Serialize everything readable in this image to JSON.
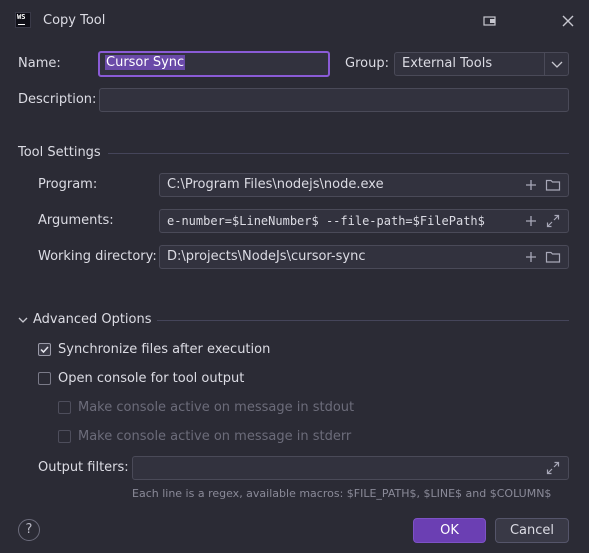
{
  "window": {
    "title": "Copy Tool",
    "app_icon_text": "WS"
  },
  "form": {
    "name_label": "Name:",
    "name_value": "Cursor Sync",
    "group_label": "Group:",
    "group_value": "External Tools",
    "description_label": "Description:",
    "description_value": ""
  },
  "tool_settings": {
    "heading": "Tool Settings",
    "program_label": "Program:",
    "program_value": "C:\\Program Files\\nodejs\\node.exe",
    "arguments_label": "Arguments:",
    "arguments_value": "e-number=$LineNumber$ --file-path=$FilePath$",
    "working_dir_label": "Working directory:",
    "working_dir_value": "D:\\projects\\NodeJs\\cursor-sync"
  },
  "advanced": {
    "heading": "Advanced Options",
    "options": [
      {
        "label": "Synchronize files after execution",
        "checked": true,
        "enabled": true
      },
      {
        "label": "Open console for tool output",
        "checked": false,
        "enabled": true
      },
      {
        "label": "Make console active on message in stdout",
        "checked": false,
        "enabled": false
      },
      {
        "label": "Make console active on message in stderr",
        "checked": false,
        "enabled": false
      }
    ],
    "output_filters_label": "Output filters:",
    "output_filters_value": "",
    "hint": "Each line is a regex, available macros: $FILE_PATH$, $LINE$ and $COLUMN$"
  },
  "buttons": {
    "help": "?",
    "ok": "OK",
    "cancel": "Cancel"
  },
  "icons": {
    "add": "+",
    "folder": "folder-icon",
    "expand": "expand-icon",
    "close": "×",
    "chevron": "chevron-down-icon"
  },
  "colors": {
    "background": "#2b2b35",
    "accent": "#6b3fb3",
    "focus_border": "#8a5bd6"
  }
}
